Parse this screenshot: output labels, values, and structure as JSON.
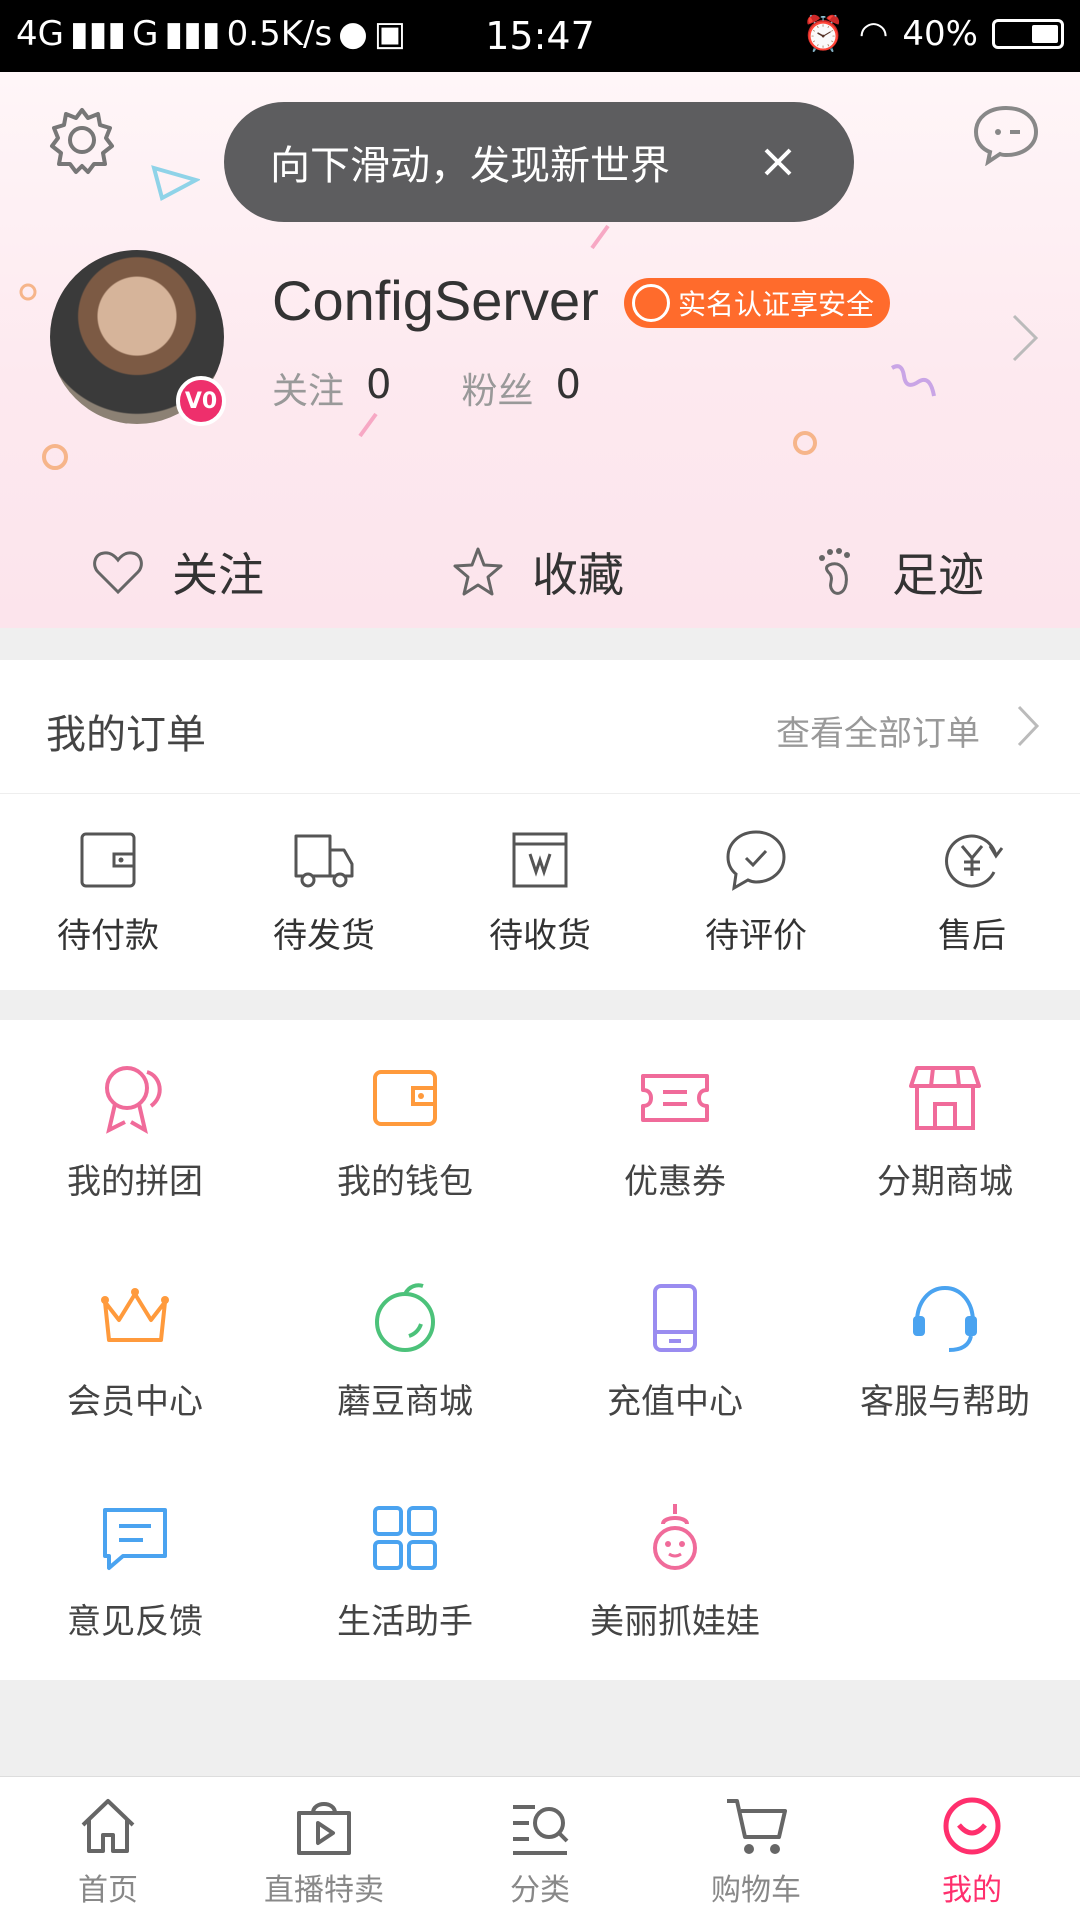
{
  "status_bar": {
    "signal_text": "4G",
    "network2": "G",
    "speed": "0.5K/s",
    "time": "15:47",
    "battery": "40%"
  },
  "header": {
    "toast_text": "向下滑动，发现新世界",
    "username": "ConfigServer",
    "verify_badge": "实名认证享安全",
    "following_label": "关注",
    "following_count": "0",
    "fans_label": "粉丝",
    "fans_count": "0",
    "avatar_badge": "V0"
  },
  "quick_links": [
    {
      "label": "关注",
      "icon": "heart-icon"
    },
    {
      "label": "收藏",
      "icon": "star-icon"
    },
    {
      "label": "足迹",
      "icon": "footprint-icon"
    }
  ],
  "orders": {
    "title": "我的订单",
    "view_all": "查看全部订单",
    "items": [
      {
        "label": "待付款",
        "icon": "wallet-icon"
      },
      {
        "label": "待发货",
        "icon": "truck-icon"
      },
      {
        "label": "待收货",
        "icon": "package-icon"
      },
      {
        "label": "待评价",
        "icon": "comment-check-icon"
      },
      {
        "label": "售后",
        "icon": "yen-icon"
      }
    ]
  },
  "services": [
    {
      "label": "我的拼团",
      "icon": "group-icon",
      "color": "#f06b9a"
    },
    {
      "label": "我的钱包",
      "icon": "wallet-icon",
      "color": "#ff9a3c"
    },
    {
      "label": "优惠券",
      "icon": "coupon-icon",
      "color": "#f06b9a"
    },
    {
      "label": "分期商城",
      "icon": "store-icon",
      "color": "#f06b9a"
    },
    {
      "label": "会员中心",
      "icon": "crown-icon",
      "color": "#ff9a3c"
    },
    {
      "label": "蘑豆商城",
      "icon": "bean-icon",
      "color": "#4cc27a"
    },
    {
      "label": "充值中心",
      "icon": "phone-icon",
      "color": "#9a8cf0"
    },
    {
      "label": "客服与帮助",
      "icon": "headset-icon",
      "color": "#4aa3f0"
    },
    {
      "label": "意见反馈",
      "icon": "feedback-icon",
      "color": "#4aa3f0"
    },
    {
      "label": "生活助手",
      "icon": "grid-icon",
      "color": "#4aa3f0"
    },
    {
      "label": "美丽抓娃娃",
      "icon": "claw-doll-icon",
      "color": "#f06b9a"
    }
  ],
  "tabs": [
    {
      "label": "首页",
      "icon": "home-icon",
      "active": false
    },
    {
      "label": "直播特卖",
      "icon": "live-bag-icon",
      "active": false
    },
    {
      "label": "分类",
      "icon": "category-search-icon",
      "active": false
    },
    {
      "label": "购物车",
      "icon": "cart-icon",
      "active": false
    },
    {
      "label": "我的",
      "icon": "smile-icon",
      "active": true
    }
  ],
  "colors": {
    "accent": "#ff2f6d",
    "badge_orange": "#ff6b2c",
    "toast_bg": "#5d5d5f"
  }
}
